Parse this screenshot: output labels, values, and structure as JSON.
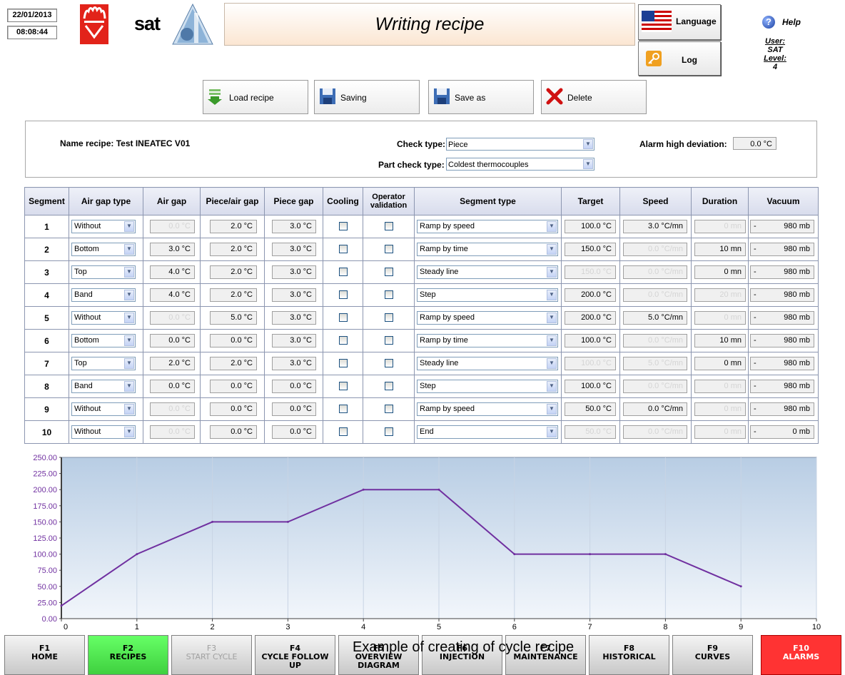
{
  "clock": {
    "date": "22/01/2013",
    "time": "08:08:44"
  },
  "brand": {
    "sat": "sat"
  },
  "title": "Writing recipe",
  "top_buttons": {
    "language": "Language",
    "log": "Log"
  },
  "help": {
    "label": "Help",
    "user_label": "User:",
    "user": "SAT",
    "level_label": "Level:",
    "level": "4"
  },
  "toolbar": {
    "load": "Load recipe",
    "saving": "Saving",
    "save_as": "Save as",
    "delete": "Delete"
  },
  "recipe": {
    "name_label": "Name recipe: Test INEATEC V01",
    "check_type_label": "Check type:",
    "check_type": "Piece",
    "part_check_type_label": "Part check type:",
    "part_check_type": "Coldest thermocouples",
    "alarm_label": "Alarm high deviation:",
    "alarm_value": "0.0 °C"
  },
  "table": {
    "headers": [
      "Segment",
      "Air gap type",
      "Air gap",
      "Piece/air gap",
      "Piece gap",
      "Cooling",
      "Operator validation",
      "Segment type",
      "Target",
      "Speed",
      "Duration",
      "Vacuum"
    ],
    "rows": [
      {
        "seg": "1",
        "gap_type": "Without",
        "air_gap": "0.0 °C",
        "piece_air": "2.0 °C",
        "piece_gap": "3.0 °C",
        "seg_type": "Ramp by speed",
        "target": "100.0 °C",
        "speed": "3.0 °C/mn",
        "duration": "0 mn",
        "vac_sign": "-",
        "vacuum": "980 mb",
        "dis": {
          "air_gap": true,
          "target": false,
          "speed": false,
          "duration": true
        }
      },
      {
        "seg": "2",
        "gap_type": "Bottom",
        "air_gap": "3.0 °C",
        "piece_air": "2.0 °C",
        "piece_gap": "3.0 °C",
        "seg_type": "Ramp by time",
        "target": "150.0 °C",
        "speed": "0.0 °C/mn",
        "duration": "10 mn",
        "vac_sign": "-",
        "vacuum": "980 mb",
        "dis": {
          "air_gap": false,
          "target": false,
          "speed": true,
          "duration": false
        }
      },
      {
        "seg": "3",
        "gap_type": "Top",
        "air_gap": "4.0 °C",
        "piece_air": "2.0 °C",
        "piece_gap": "3.0 °C",
        "seg_type": "Steady line",
        "target": "150.0 °C",
        "speed": "0.0 °C/mn",
        "duration": "0 mn",
        "vac_sign": "-",
        "vacuum": "980 mb",
        "dis": {
          "air_gap": false,
          "target": true,
          "speed": true,
          "duration": false
        }
      },
      {
        "seg": "4",
        "gap_type": "Band",
        "air_gap": "4.0 °C",
        "piece_air": "2.0 °C",
        "piece_gap": "3.0 °C",
        "seg_type": "Step",
        "target": "200.0 °C",
        "speed": "0.0 °C/mn",
        "duration": "20 mn",
        "vac_sign": "-",
        "vacuum": "980 mb",
        "dis": {
          "air_gap": false,
          "target": false,
          "speed": true,
          "duration": true
        }
      },
      {
        "seg": "5",
        "gap_type": "Without",
        "air_gap": "0.0 °C",
        "piece_air": "5.0 °C",
        "piece_gap": "3.0 °C",
        "seg_type": "Ramp by speed",
        "target": "200.0 °C",
        "speed": "5.0 °C/mn",
        "duration": "0 mn",
        "vac_sign": "-",
        "vacuum": "980 mb",
        "dis": {
          "air_gap": true,
          "target": false,
          "speed": false,
          "duration": true
        }
      },
      {
        "seg": "6",
        "gap_type": "Bottom",
        "air_gap": "0.0 °C",
        "piece_air": "0.0 °C",
        "piece_gap": "3.0 °C",
        "seg_type": "Ramp by time",
        "target": "100.0 °C",
        "speed": "0.0 °C/mn",
        "duration": "10 mn",
        "vac_sign": "-",
        "vacuum": "980 mb",
        "dis": {
          "air_gap": false,
          "target": false,
          "speed": true,
          "duration": false
        }
      },
      {
        "seg": "7",
        "gap_type": "Top",
        "air_gap": "2.0 °C",
        "piece_air": "2.0 °C",
        "piece_gap": "3.0 °C",
        "seg_type": "Steady line",
        "target": "100.0 °C",
        "speed": "5.0 °C/mn",
        "duration": "0 mn",
        "vac_sign": "-",
        "vacuum": "980 mb",
        "dis": {
          "air_gap": false,
          "target": true,
          "speed": true,
          "duration": false
        }
      },
      {
        "seg": "8",
        "gap_type": "Band",
        "air_gap": "0.0 °C",
        "piece_air": "0.0 °C",
        "piece_gap": "0.0 °C",
        "seg_type": "Step",
        "target": "100.0 °C",
        "speed": "0.0 °C/mn",
        "duration": "0 mn",
        "vac_sign": "-",
        "vacuum": "980 mb",
        "dis": {
          "air_gap": false,
          "target": false,
          "speed": true,
          "duration": true
        }
      },
      {
        "seg": "9",
        "gap_type": "Without",
        "air_gap": "0.0 °C",
        "piece_air": "0.0 °C",
        "piece_gap": "0.0 °C",
        "seg_type": "Ramp by speed",
        "target": "50.0 °C",
        "speed": "0.0 °C/mn",
        "duration": "0 mn",
        "vac_sign": "-",
        "vacuum": "980 mb",
        "dis": {
          "air_gap": true,
          "target": false,
          "speed": false,
          "duration": true
        }
      },
      {
        "seg": "10",
        "gap_type": "Without",
        "air_gap": "0.0 °C",
        "piece_air": "0.0 °C",
        "piece_gap": "0.0 °C",
        "seg_type": "End",
        "target": "50.0 °C",
        "speed": "0.0 °C/mn",
        "duration": "0 mn",
        "vac_sign": "-",
        "vacuum": "0 mb",
        "dis": {
          "air_gap": true,
          "target": true,
          "speed": true,
          "duration": true
        }
      }
    ]
  },
  "chart_data": {
    "type": "line",
    "x": [
      0,
      1,
      2,
      3,
      4,
      5,
      6,
      7,
      8,
      9
    ],
    "values": [
      20,
      100,
      150,
      150,
      200,
      200,
      100,
      100,
      100,
      50
    ],
    "xlim": [
      0,
      10
    ],
    "ylim": [
      0,
      250
    ],
    "xticks": [
      "0",
      "1",
      "2",
      "3",
      "4",
      "5",
      "6",
      "7",
      "8",
      "9",
      "10"
    ],
    "yticks": [
      "0.00",
      "25.00",
      "50.00",
      "75.00",
      "100.00",
      "125.00",
      "150.00",
      "175.00",
      "200.00",
      "225.00",
      "250.00"
    ],
    "grid": true,
    "line_color": "#7030a0",
    "caption": "Example of creating of cycle recipe"
  },
  "fkeys": [
    {
      "key": "F1",
      "label": "HOME",
      "state": "normal"
    },
    {
      "key": "F2",
      "label": "RECIPES",
      "state": "active"
    },
    {
      "key": "F3",
      "label": "START CYCLE",
      "state": "disabled"
    },
    {
      "key": "F4",
      "label": "CYCLE FOLLOW UP",
      "state": "normal"
    },
    {
      "key": "F5",
      "label": "OVERVIEW DIAGRAM",
      "state": "normal"
    },
    {
      "key": "F6",
      "label": "INJECTION",
      "state": "normal"
    },
    {
      "key": "F7",
      "label": "MAINTENANCE",
      "state": "normal"
    },
    {
      "key": "F8",
      "label": "HISTORICAL",
      "state": "normal"
    },
    {
      "key": "F9",
      "label": "CURVES",
      "state": "normal"
    },
    {
      "key": "F10",
      "label": "ALARMS",
      "state": "alarm"
    }
  ],
  "colors": {
    "active": "#66ff66",
    "alarm": "#ff3333",
    "disabled_text": "#a0a0a0"
  }
}
